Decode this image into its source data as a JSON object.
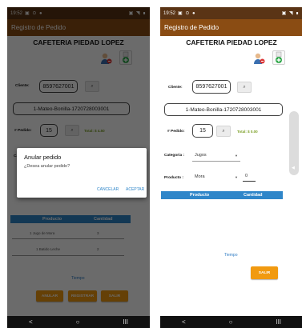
{
  "status": {
    "time": "19:52",
    "icons": "▣ ⊙ ●",
    "right": "▣ ◥ ∎"
  },
  "app": {
    "title": "Registro de Pedido",
    "shop_name": "CAFETERIA PIEDAD LOPEZ"
  },
  "form": {
    "cliente_label": "Cliente:",
    "cliente_id": "8597627001",
    "cliente_nombre": "1-Mateo-Bonilla-1720728003001",
    "pedido_label": "# Pedido:",
    "pedido_num": "15",
    "total_left": "Total: $ 4.50",
    "total_right": "Total: $ 0.00",
    "categoria_label": "Categoria :",
    "categoria_value": "Jugos",
    "producto_label": "Producto :",
    "producto_value": "Mora",
    "cantidad_value": "0"
  },
  "table": {
    "col_producto": "Producto",
    "col_cantidad": "Cantidad"
  },
  "rows": [
    {
      "name": "1 Jugo de Mora",
      "qty": "3"
    },
    {
      "name": "1 Batido Leche",
      "qty": "2"
    }
  ],
  "tiempo": "Tiempo",
  "buttons": {
    "anular": "ANULAR",
    "registrar": "REGISTRAR",
    "salir": "SALIR"
  },
  "dialog": {
    "title": "Anular pedido",
    "message": "¿Desea anular pedido?",
    "cancel": "CANCELAR",
    "accept": "ACEPTAR"
  },
  "nav": {
    "back": "<",
    "home": "○",
    "recent": "III"
  },
  "colors": {
    "appbar": "#8a4c13",
    "statusbar": "#5a3415",
    "accent_blue": "#2f86c9",
    "button_orange": "#f19a10"
  }
}
